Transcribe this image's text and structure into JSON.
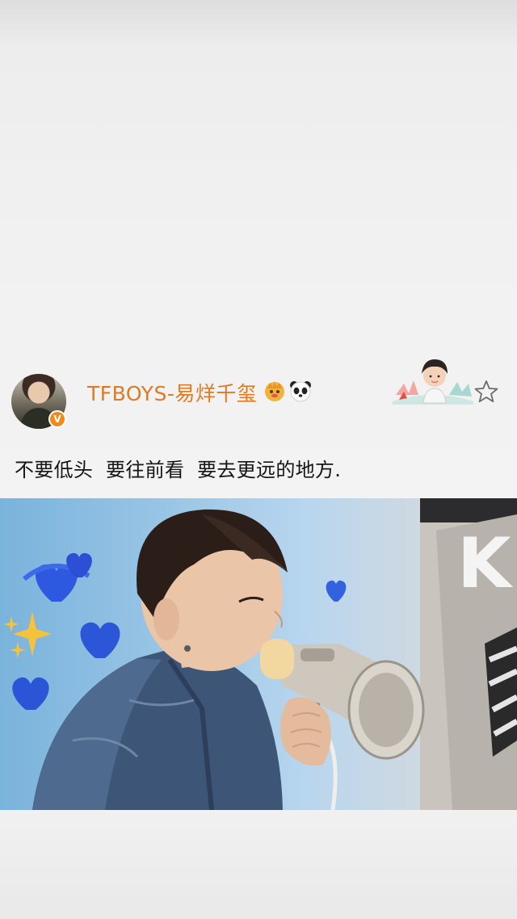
{
  "post": {
    "username": "TFBOYS-易烊千玺",
    "badges": [
      "crown-icon",
      "panda-icon"
    ],
    "verified_icon": "verified-v-badge",
    "verified_letter": "V",
    "text": "不要低头  要往前看  要去更远的地方.",
    "accent_color": "#e07a22"
  },
  "photo": {
    "subject": "boy-with-megaphone-photo",
    "stickers": [
      "blue-heart-icon",
      "blue-heart-icon",
      "blue-heart-icon",
      "blue-heart-icon",
      "sparkle-icon"
    ],
    "background_letter": "K"
  },
  "actions": {
    "favorite_icon": "star-outline-icon"
  }
}
